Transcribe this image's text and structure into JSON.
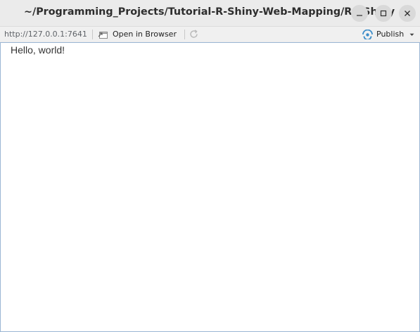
{
  "window": {
    "title": "~/Programming_Projects/Tutorial-R-Shiny-Web-Mapping/R - Shiny"
  },
  "toolbar": {
    "url": "http://127.0.0.1:7641",
    "open_in_browser_label": "Open in Browser",
    "publish_label": "Publish"
  },
  "app": {
    "text": "Hello, world!"
  },
  "colors": {
    "publish_accent": "#3a8cc9"
  }
}
